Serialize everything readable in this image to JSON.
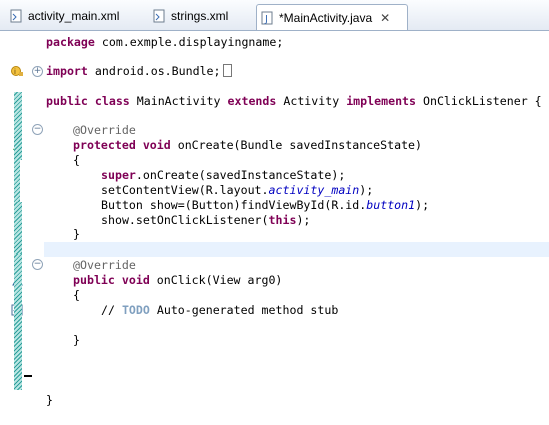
{
  "tabs": [
    {
      "label": "activity_main.xml",
      "active": false
    },
    {
      "label": "strings.xml",
      "active": false
    },
    {
      "label": "*MainActivity.java",
      "active": true
    }
  ],
  "editor": {
    "lines": {
      "package": "package com.exmple.displayingname;",
      "import": "import android.os.Bundle;",
      "class_decl": "public class MainActivity extends Activity implements OnClickListener {",
      "override1": "@Override",
      "oncreate_sig": "protected void onCreate(Bundle savedInstanceState)",
      "brace_open1": "{",
      "super_call": "super.onCreate(savedInstanceState);",
      "set_content": "setContentView(R.layout.activity_main);",
      "find_view": "Button show=(Button)findViewById(R.id.button1);",
      "set_listener": "show.setOnClickListener(this);",
      "brace_close1": "}",
      "override2": "@Override",
      "onclick_sig": "public void onClick(View arg0)",
      "brace_open2": "{",
      "todo_comment": "// TODO Auto-generated method stub",
      "brace_close2": "}",
      "class_close": "}"
    }
  },
  "colors": {
    "keyword": "#7f0055",
    "annotation": "#646464",
    "field": "#0000c0",
    "comment": "#3f7f5f",
    "current_line": "#e8f2fe"
  }
}
